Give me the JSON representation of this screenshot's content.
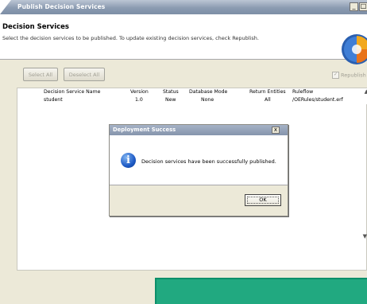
{
  "window": {
    "title": "Publish Decision Services",
    "controls": {
      "minimize": "_",
      "restore": "□"
    }
  },
  "header": {
    "title": "Decision Services",
    "description": "Select the decision services to be published.  To update existing decision services, check Republish."
  },
  "toolbar": {
    "select_all": "Select All",
    "deselect_all": "Deselect All",
    "republish": "Republish"
  },
  "table": {
    "columns": [
      "Decision Service Name",
      "Version",
      "Status",
      "Database Mode",
      "Return Entities",
      "Ruleflow"
    ],
    "rows": [
      {
        "checked": true,
        "name": "student",
        "version": "1.0",
        "status": "New",
        "database_mode": "None",
        "return_entities": "All",
        "ruleflow": "/OERules/student.erf"
      }
    ]
  },
  "dialog": {
    "title": "Deployment Success",
    "close": "x",
    "message": "Decision services have been successfully published.",
    "ok": "OK"
  },
  "colors": {
    "title_bar": "#8b9bb1",
    "dialog_title_bar": "#8594ac",
    "info_icon": "#1e5bc6",
    "teal_panel": "#21a980"
  },
  "icons": {
    "info": "info-icon",
    "logo": "app-logo-icon",
    "check": "checkbox-checked-icon"
  }
}
